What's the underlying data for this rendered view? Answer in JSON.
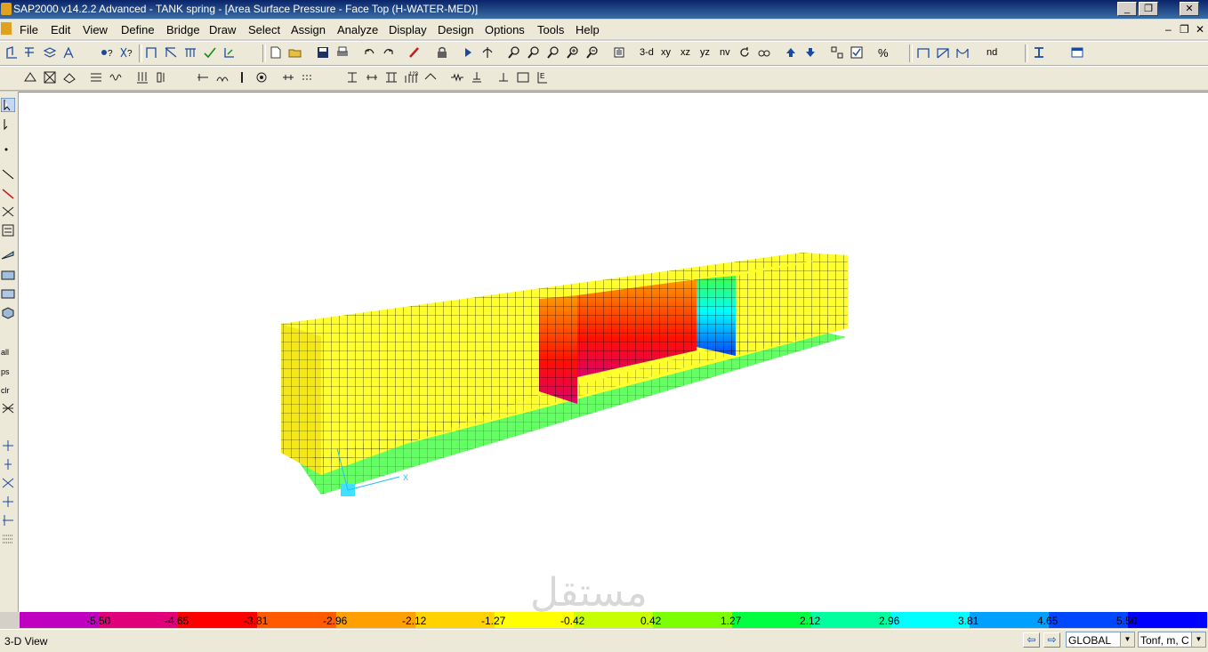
{
  "window": {
    "title": "SAP2000 v14.2.2 Advanced  - TANK spring - [Area Surface Pressure - Face Top (H-WATER-MED)]",
    "minimize": "_",
    "restore": "❐",
    "close": "✕"
  },
  "menu": {
    "items": [
      "File",
      "Edit",
      "View",
      "Define",
      "Bridge",
      "Draw",
      "Select",
      "Assign",
      "Analyze",
      "Display",
      "Design",
      "Options",
      "Tools",
      "Help"
    ],
    "mdi_min": "–",
    "mdi_restore": "❐",
    "mdi_close": "✕"
  },
  "toolbar": {
    "view_3d": "3-d",
    "view_xy": "xy",
    "view_xz": "xz",
    "view_yz": "yz",
    "view_nv": "nv",
    "nd": "nd"
  },
  "viewport": {
    "axis_x": "X",
    "watermark": "مستقل"
  },
  "legend": {
    "values": [
      "-5.50",
      "-4.65",
      "-3.81",
      "-2.96",
      "-2.12",
      "-1.27",
      "-0.42",
      "0.42",
      "1.27",
      "2.12",
      "2.96",
      "3.81",
      "4.65",
      "5.50"
    ],
    "colors": [
      "#c000c0",
      "#e0007a",
      "#ff0000",
      "#ff5a00",
      "#ff9f00",
      "#ffd200",
      "#ffff00",
      "#c8ff00",
      "#7cff00",
      "#00ff40",
      "#00ff9f",
      "#00ffff",
      "#00a0ff",
      "#0048ff",
      "#0000ff"
    ]
  },
  "status": {
    "view_name": "3-D View",
    "coord_system": "GLOBAL",
    "units": "Tonf, m, C"
  }
}
